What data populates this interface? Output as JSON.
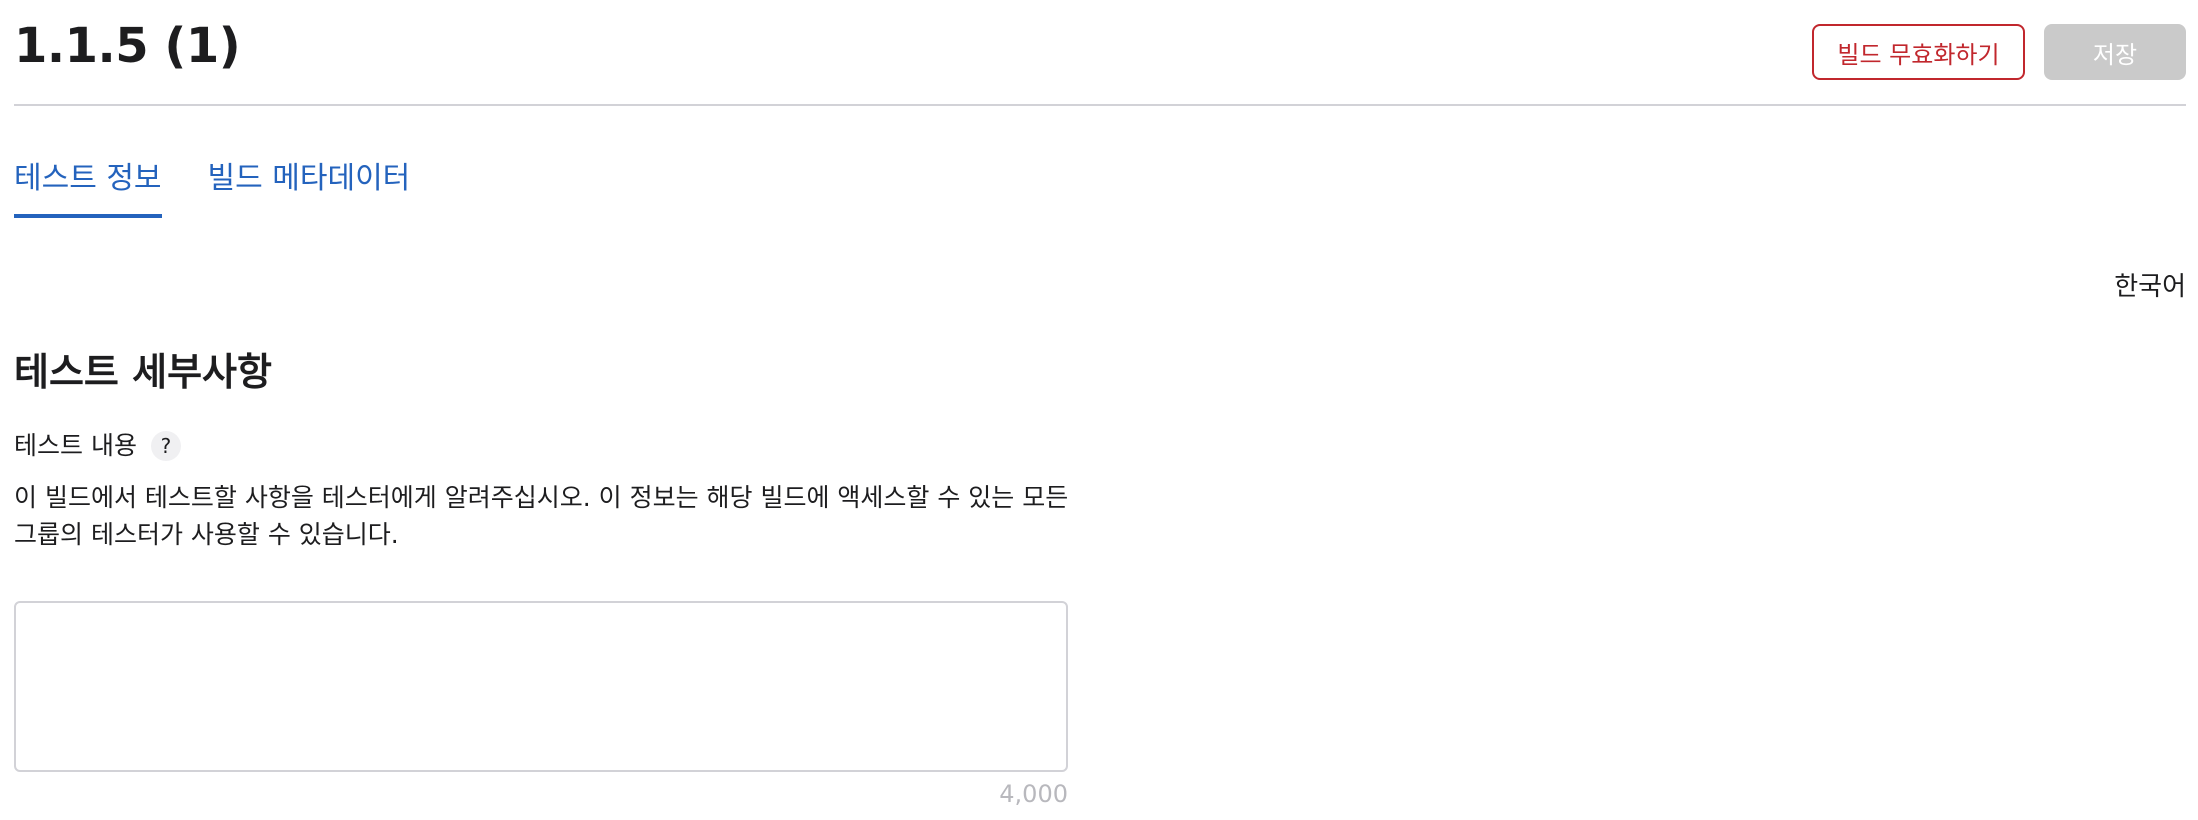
{
  "header": {
    "build_title": "1.1.5 (1)",
    "expire_button_label": "빌드 무효화하기",
    "save_button_label": "저장"
  },
  "tabs": [
    {
      "label": "테스트 정보",
      "active": true
    },
    {
      "label": "빌드 메타데이터",
      "active": false
    }
  ],
  "language": "한국어",
  "section": {
    "title": "테스트 세부사항",
    "field_label": "테스트 내용",
    "help_icon": "?",
    "description": "이 빌드에서 테스트할 사항을 테스터에게 알려주십시오. 이 정보는 해당 빌드에 액세스할 수 있는 모든 그룹의 테스터가 사용할 수 있습니다.",
    "textarea_value": "",
    "char_limit": "4,000"
  },
  "colors": {
    "accent_blue": "#2463bd",
    "danger_red": "#c1272d",
    "disabled_gray": "#cacaca",
    "divider": "#d2d2d7"
  },
  "icons": {
    "help": "question-mark-icon"
  }
}
